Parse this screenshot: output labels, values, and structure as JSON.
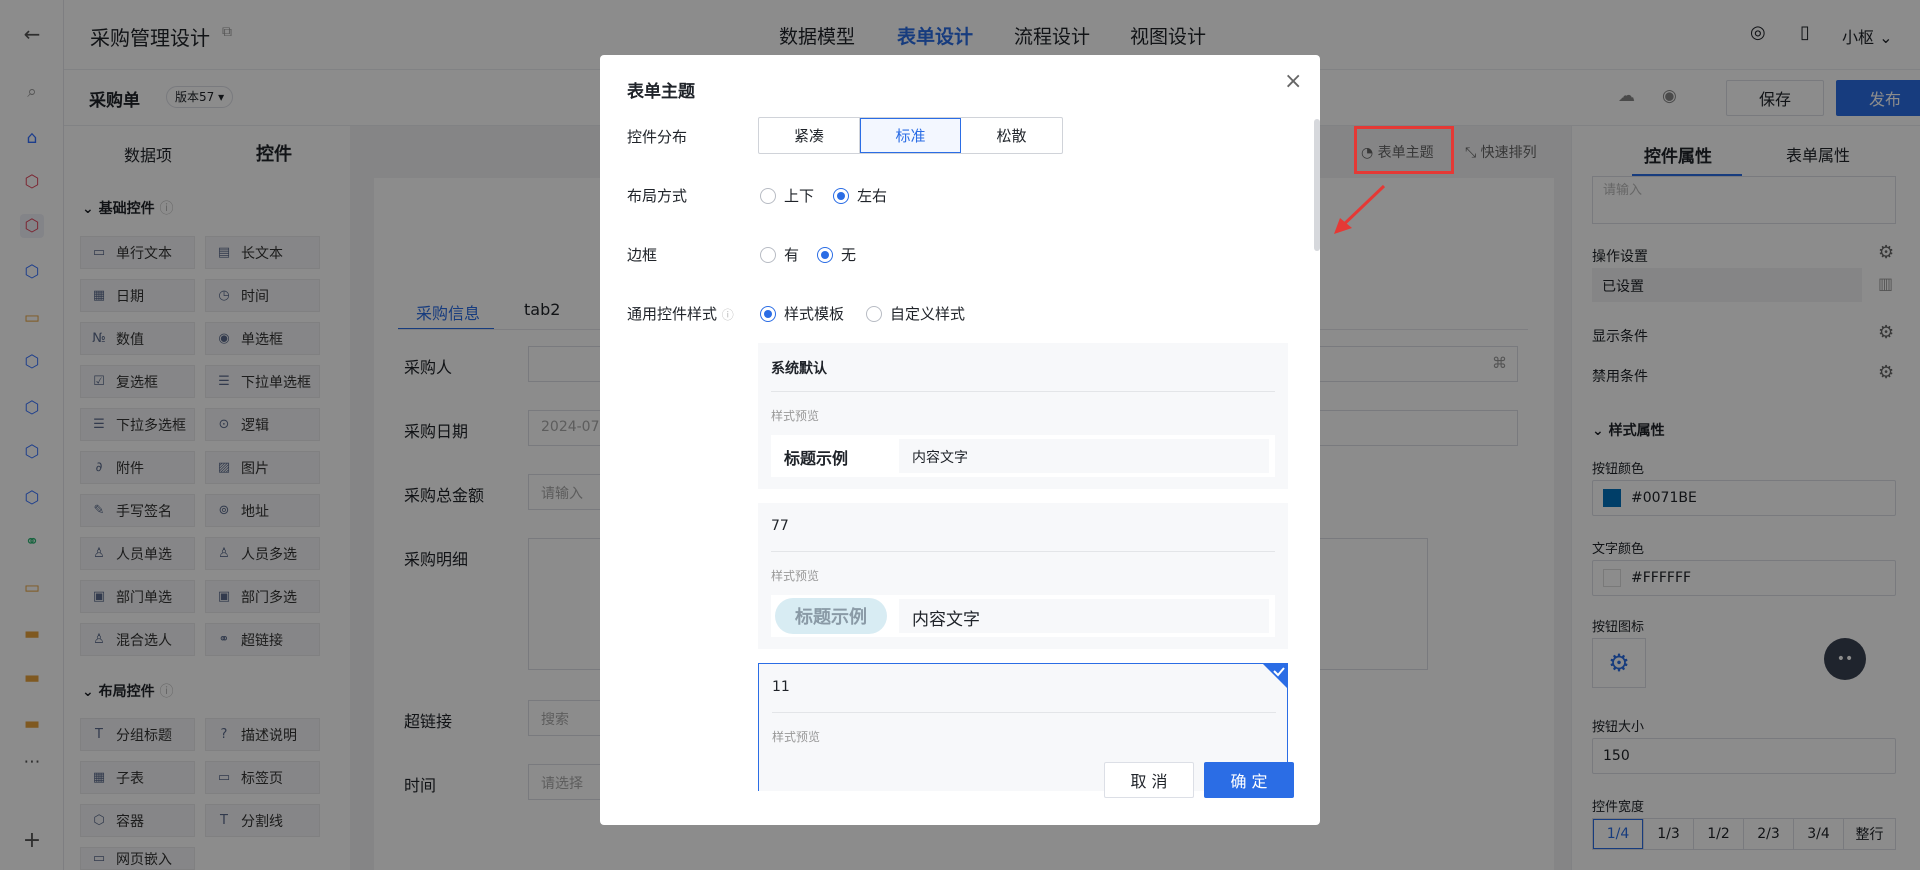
{
  "app": {
    "title": "采购管理设计",
    "tabs": [
      "数据模型",
      "表单设计",
      "流程设计",
      "视图设计"
    ],
    "active_tab": "表单设计",
    "user": "小枢"
  },
  "subbar": {
    "form_name": "采购单",
    "version": "版本57",
    "save": "保存",
    "publish": "发布"
  },
  "left": {
    "tabs": [
      "数据项",
      "控件"
    ],
    "basic_title": "基础控件",
    "layout_title": "布局控件",
    "basic": [
      "单行文本",
      "长文本",
      "日期",
      "时间",
      "数值",
      "单选框",
      "复选框",
      "下拉单选框",
      "下拉多选框",
      "逻辑",
      "附件",
      "图片",
      "手写签名",
      "地址",
      "人员单选",
      "人员多选",
      "部门单选",
      "部门多选",
      "混合选人",
      "超链接"
    ],
    "layout": [
      "分组标题",
      "描述说明",
      "子表",
      "标签页",
      "容器",
      "分割线",
      "网页嵌入"
    ]
  },
  "canvas": {
    "toolbar": {
      "theme": "表单主题",
      "sort": "快速排列"
    },
    "tabs": [
      "采购信息",
      "tab2"
    ],
    "fields": [
      {
        "label": "采购人",
        "value": ""
      },
      {
        "label": "采购日期",
        "value": "2024-07-"
      },
      {
        "label": "采购总金额",
        "value": "请输入"
      },
      {
        "label": "采购明细",
        "value": ""
      },
      {
        "label": "超链接",
        "value": "搜索"
      },
      {
        "label": "时间",
        "value": "请选择"
      }
    ]
  },
  "right": {
    "tabs": [
      "控件属性",
      "表单属性"
    ],
    "placeholder": "请输入",
    "op_label": "操作设置",
    "op_value": "已设置",
    "show_cond": "显示条件",
    "disable_cond": "禁用条件",
    "style_title": "样式属性",
    "btn_color_label": "按钮颜色",
    "btn_color": "#0071BE",
    "text_color_label": "文字颜色",
    "text_color": "#FFFFFF",
    "icon_label": "按钮图标",
    "size_label": "按钮大小",
    "size_value": "150",
    "width_label": "控件宽度",
    "widths": [
      "1/4",
      "1/3",
      "1/2",
      "2/3",
      "3/4",
      "整行"
    ]
  },
  "modal": {
    "title": "表单主题",
    "dist_label": "控件分布",
    "dist": [
      "紧凑",
      "标准",
      "松散"
    ],
    "layout_label": "布局方式",
    "layout_opts": [
      "上下",
      "左右"
    ],
    "border_label": "边框",
    "border_opts": [
      "有",
      "无"
    ],
    "style_label": "通用控件样式",
    "style_opts": [
      "样式模板",
      "自定义样式"
    ],
    "cards": [
      {
        "name": "系统默认",
        "preview": "样式预览",
        "sample_title": "标题示例",
        "sample_content": "内容文字"
      },
      {
        "name": "77",
        "preview": "样式预览",
        "sample_title": "标题示例",
        "sample_content": "内容文字"
      },
      {
        "name": "11",
        "preview": "样式预览"
      }
    ],
    "cancel": "取 消",
    "ok": "确 定"
  },
  "colors": {
    "accent": "#2b6de5",
    "btn_color": "#0071BE"
  }
}
